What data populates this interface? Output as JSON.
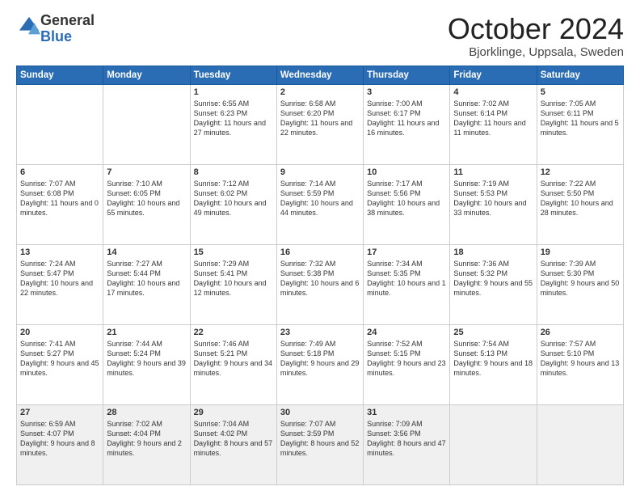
{
  "logo": {
    "general": "General",
    "blue": "Blue"
  },
  "header": {
    "month": "October 2024",
    "location": "Bjorklinge, Uppsala, Sweden"
  },
  "weekdays": [
    "Sunday",
    "Monday",
    "Tuesday",
    "Wednesday",
    "Thursday",
    "Friday",
    "Saturday"
  ],
  "weeks": [
    [
      {
        "day": null,
        "info": null
      },
      {
        "day": null,
        "info": null
      },
      {
        "day": "1",
        "info": "Sunrise: 6:55 AM\nSunset: 6:23 PM\nDaylight: 11 hours\nand 27 minutes."
      },
      {
        "day": "2",
        "info": "Sunrise: 6:58 AM\nSunset: 6:20 PM\nDaylight: 11 hours\nand 22 minutes."
      },
      {
        "day": "3",
        "info": "Sunrise: 7:00 AM\nSunset: 6:17 PM\nDaylight: 11 hours\nand 16 minutes."
      },
      {
        "day": "4",
        "info": "Sunrise: 7:02 AM\nSunset: 6:14 PM\nDaylight: 11 hours\nand 11 minutes."
      },
      {
        "day": "5",
        "info": "Sunrise: 7:05 AM\nSunset: 6:11 PM\nDaylight: 11 hours\nand 5 minutes."
      }
    ],
    [
      {
        "day": "6",
        "info": "Sunrise: 7:07 AM\nSunset: 6:08 PM\nDaylight: 11 hours\nand 0 minutes."
      },
      {
        "day": "7",
        "info": "Sunrise: 7:10 AM\nSunset: 6:05 PM\nDaylight: 10 hours\nand 55 minutes."
      },
      {
        "day": "8",
        "info": "Sunrise: 7:12 AM\nSunset: 6:02 PM\nDaylight: 10 hours\nand 49 minutes."
      },
      {
        "day": "9",
        "info": "Sunrise: 7:14 AM\nSunset: 5:59 PM\nDaylight: 10 hours\nand 44 minutes."
      },
      {
        "day": "10",
        "info": "Sunrise: 7:17 AM\nSunset: 5:56 PM\nDaylight: 10 hours\nand 38 minutes."
      },
      {
        "day": "11",
        "info": "Sunrise: 7:19 AM\nSunset: 5:53 PM\nDaylight: 10 hours\nand 33 minutes."
      },
      {
        "day": "12",
        "info": "Sunrise: 7:22 AM\nSunset: 5:50 PM\nDaylight: 10 hours\nand 28 minutes."
      }
    ],
    [
      {
        "day": "13",
        "info": "Sunrise: 7:24 AM\nSunset: 5:47 PM\nDaylight: 10 hours\nand 22 minutes."
      },
      {
        "day": "14",
        "info": "Sunrise: 7:27 AM\nSunset: 5:44 PM\nDaylight: 10 hours\nand 17 minutes."
      },
      {
        "day": "15",
        "info": "Sunrise: 7:29 AM\nSunset: 5:41 PM\nDaylight: 10 hours\nand 12 minutes."
      },
      {
        "day": "16",
        "info": "Sunrise: 7:32 AM\nSunset: 5:38 PM\nDaylight: 10 hours\nand 6 minutes."
      },
      {
        "day": "17",
        "info": "Sunrise: 7:34 AM\nSunset: 5:35 PM\nDaylight: 10 hours\nand 1 minute."
      },
      {
        "day": "18",
        "info": "Sunrise: 7:36 AM\nSunset: 5:32 PM\nDaylight: 9 hours\nand 55 minutes."
      },
      {
        "day": "19",
        "info": "Sunrise: 7:39 AM\nSunset: 5:30 PM\nDaylight: 9 hours\nand 50 minutes."
      }
    ],
    [
      {
        "day": "20",
        "info": "Sunrise: 7:41 AM\nSunset: 5:27 PM\nDaylight: 9 hours\nand 45 minutes."
      },
      {
        "day": "21",
        "info": "Sunrise: 7:44 AM\nSunset: 5:24 PM\nDaylight: 9 hours\nand 39 minutes."
      },
      {
        "day": "22",
        "info": "Sunrise: 7:46 AM\nSunset: 5:21 PM\nDaylight: 9 hours\nand 34 minutes."
      },
      {
        "day": "23",
        "info": "Sunrise: 7:49 AM\nSunset: 5:18 PM\nDaylight: 9 hours\nand 29 minutes."
      },
      {
        "day": "24",
        "info": "Sunrise: 7:52 AM\nSunset: 5:15 PM\nDaylight: 9 hours\nand 23 minutes."
      },
      {
        "day": "25",
        "info": "Sunrise: 7:54 AM\nSunset: 5:13 PM\nDaylight: 9 hours\nand 18 minutes."
      },
      {
        "day": "26",
        "info": "Sunrise: 7:57 AM\nSunset: 5:10 PM\nDaylight: 9 hours\nand 13 minutes."
      }
    ],
    [
      {
        "day": "27",
        "info": "Sunrise: 6:59 AM\nSunset: 4:07 PM\nDaylight: 9 hours\nand 8 minutes."
      },
      {
        "day": "28",
        "info": "Sunrise: 7:02 AM\nSunset: 4:04 PM\nDaylight: 9 hours\nand 2 minutes."
      },
      {
        "day": "29",
        "info": "Sunrise: 7:04 AM\nSunset: 4:02 PM\nDaylight: 8 hours\nand 57 minutes."
      },
      {
        "day": "30",
        "info": "Sunrise: 7:07 AM\nSunset: 3:59 PM\nDaylight: 8 hours\nand 52 minutes."
      },
      {
        "day": "31",
        "info": "Sunrise: 7:09 AM\nSunset: 3:56 PM\nDaylight: 8 hours\nand 47 minutes."
      },
      {
        "day": null,
        "info": null
      },
      {
        "day": null,
        "info": null
      }
    ]
  ]
}
